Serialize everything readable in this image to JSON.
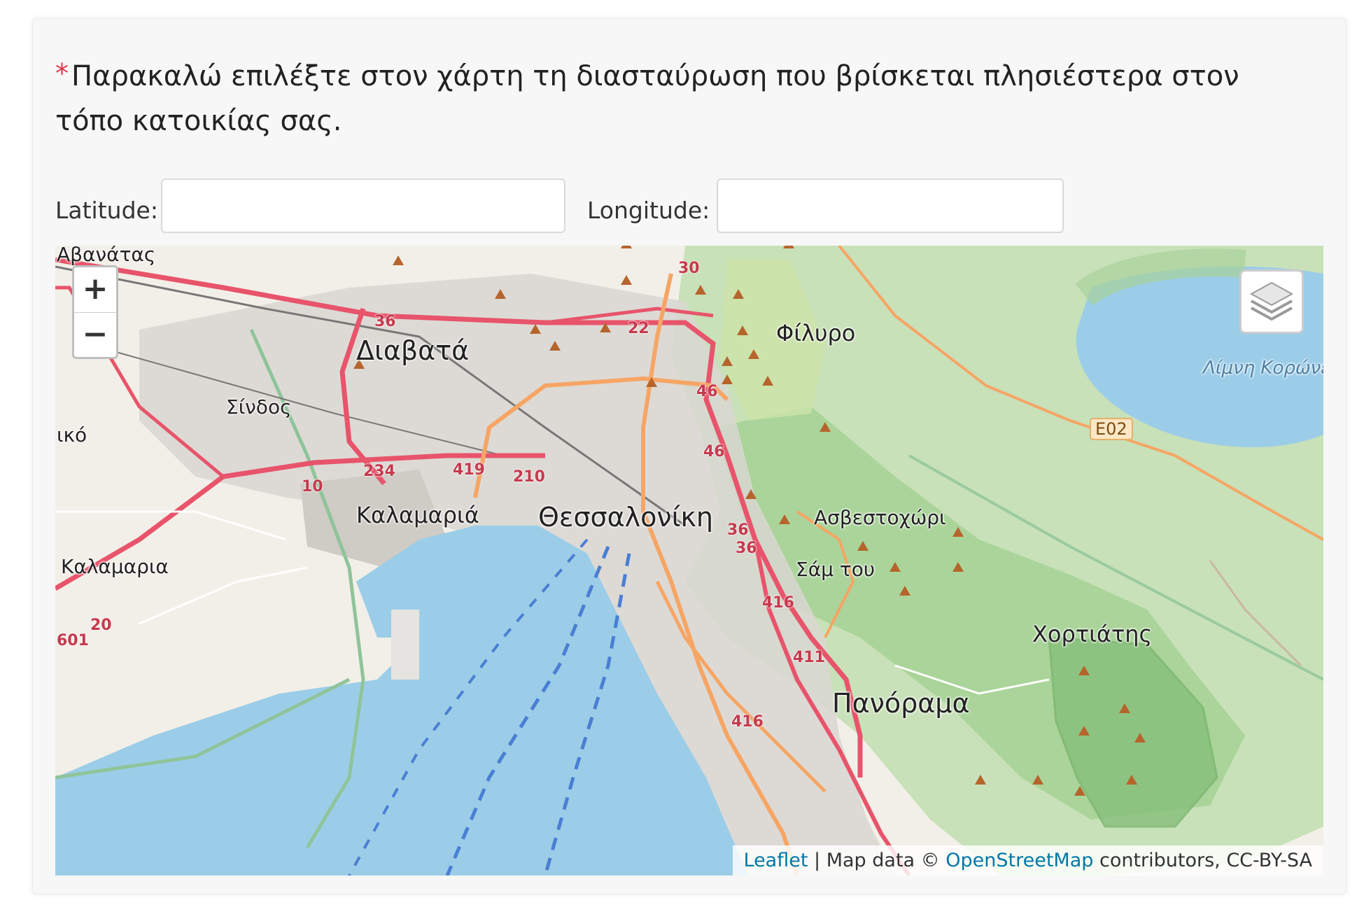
{
  "question": {
    "required_mark": "*",
    "text": "Παρακαλώ επιλέξτε στον χάρτη τη διασταύρωση που βρίσκεται πλησιέστερα στον τόπο κατοικίας σας."
  },
  "coords": {
    "latitude_label": "Latitude:",
    "latitude_value": "",
    "longitude_label": "Longitude:",
    "longitude_value": ""
  },
  "map": {
    "zoom_in_label": "+",
    "zoom_out_label": "−",
    "layers_icon": "layers-icon",
    "places": {
      "avanatas": "Αβανάτας",
      "diavata": "Διαβατά",
      "sindos": "Σίνδος",
      "iko": "ικό",
      "kalamaria_small": "Καλαμαριά",
      "kalamaria_left": "Καλαμαρια",
      "thessaloniki": "Θεσσαλονίκη",
      "filyro": "Φίλυρο",
      "asvestochori": "Ασβεστοχώρι",
      "sam_tou": "Σάμ του",
      "chortiatis": "Χορτιάτης",
      "panorama": "Πανόραμα",
      "lake": "Λίμνη Κορώνεια"
    },
    "road_numbers": {
      "r30": "30",
      "r36a": "36",
      "r22": "22",
      "r46a": "46",
      "r46b": "46",
      "r419": "419",
      "r210": "210",
      "r234": "234",
      "r10": "10",
      "r36b": "36",
      "r36c": "36",
      "r416a": "416",
      "r411": "411",
      "r416b": "416",
      "r20": "20",
      "r601": "601"
    },
    "e_road": "E02",
    "attribution": {
      "leaflet": "Leaflet",
      "separator": " | Map data © ",
      "osm": "OpenStreetMap",
      "rest": " contributors, CC-BY-SA"
    },
    "colors": {
      "sea": "#9ccde8",
      "land": "#f2efe8",
      "urban": "#d9d6d1",
      "forest": "#a8d19b",
      "forest_dark": "#86c07a",
      "primary_road": "#e8546b",
      "secondary_road": "#f6a565",
      "boundary": "#8fc49a"
    }
  }
}
